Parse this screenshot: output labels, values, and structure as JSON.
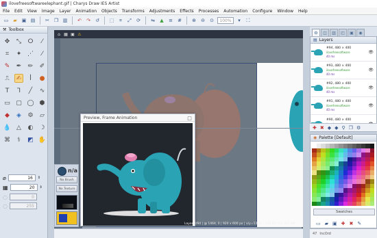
{
  "window": {
    "title": "ilovefreesoftwareelephant.gif | Charys Draw IES Artist"
  },
  "menu": [
    "File",
    "Edit",
    "View",
    "Image",
    "Layer",
    "Animation",
    "Objects",
    "Transforms",
    "Adjustments",
    "Effects",
    "Processes",
    "Automation",
    "Configure",
    "Window",
    "Help"
  ],
  "toolbar": {
    "zoom": "100%"
  },
  "toolbox": {
    "title": "Toolbox",
    "size_value": "16",
    "opacity_value": "20",
    "field3": "0",
    "field4": "255"
  },
  "brush_panel": {
    "na_label": "n/a",
    "no_brush": "No Brush",
    "no_texture": "No Texture"
  },
  "preview": {
    "title": "Preview, Frame Animation"
  },
  "layer_info": "Layer 4/94 | @ 1464, 0 | 920 x 600 px | x/y=12.10 | 102 KP of 6.929 MP",
  "status_text": "",
  "layers": {
    "title": "Layers",
    "rows": [
      {
        "name": "#94, 480 × 400",
        "sub": "ilovefreesoftware",
        "delay": "40 ms"
      },
      {
        "name": "#93, 480 × 400",
        "sub": "ilovefreesoftware",
        "delay": "40 ms"
      },
      {
        "name": "#92, 480 × 400",
        "sub": "ilovefreesoftware",
        "delay": "40 ms"
      },
      {
        "name": "#91, 480 × 400",
        "sub": "ilovefreesoftware",
        "delay": "40 ms"
      },
      {
        "name": "#90, 480 × 400",
        "sub": "ilovefreesoftware",
        "delay": "40 ms"
      }
    ]
  },
  "palette": {
    "title": "Palette [Default]",
    "swatches_label": "Swatches"
  },
  "right_status": {
    "a": "47",
    "b": "IncOrd"
  }
}
